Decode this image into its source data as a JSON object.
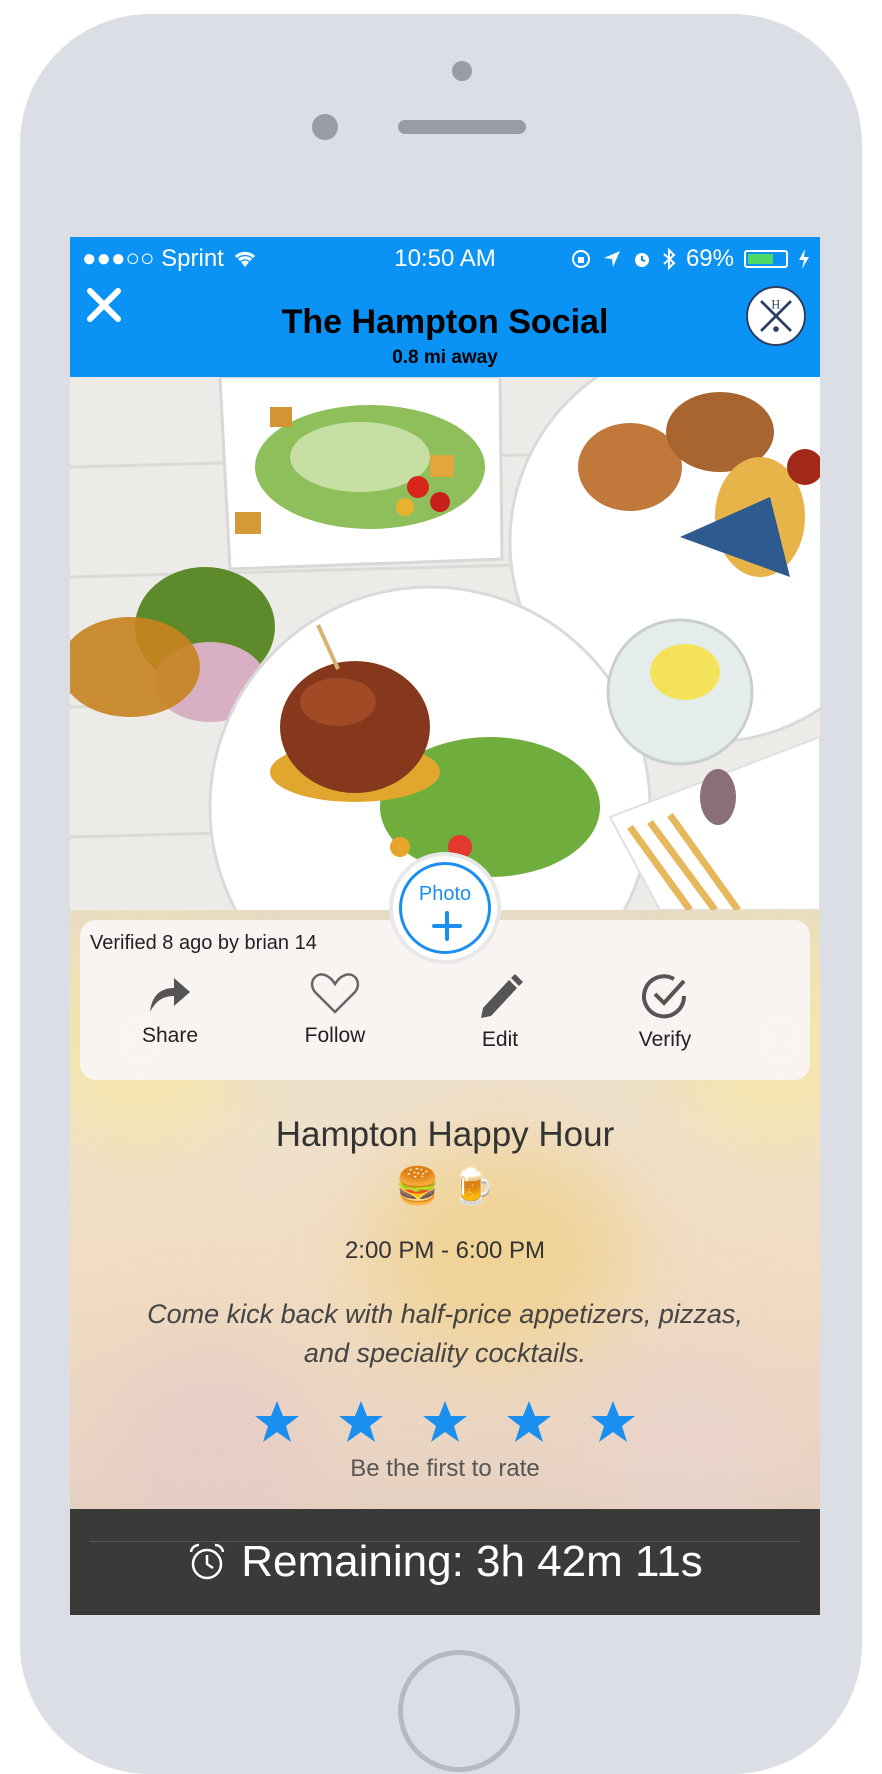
{
  "status_bar": {
    "carrier": "●●●○○ Sprint",
    "time": "10:50 AM",
    "battery": "69%",
    "battery_level": 0.69
  },
  "header": {
    "title": "The Hampton Social",
    "subtitle": "0.8 mi away"
  },
  "photo_button": {
    "label": "Photo"
  },
  "action_card": {
    "verified_text": "Verified 8 ago by brian 14",
    "actions": [
      {
        "label": "Share",
        "icon": "share-icon"
      },
      {
        "label": "Follow",
        "icon": "heart-icon"
      },
      {
        "label": "Edit",
        "icon": "pencil-icon"
      },
      {
        "label": "Verify",
        "icon": "check-circle-icon"
      }
    ]
  },
  "deal": {
    "title": "Hampton Happy Hour",
    "emoji": "🍔 🍺",
    "hours": "2:00 PM - 6:00 PM",
    "description": "Come kick back with half-price appetizers, pizzas, and speciality cocktails."
  },
  "rating": {
    "stars": 5,
    "prompt": "Be the first to rate"
  },
  "timer": {
    "text": "Remaining: 3h 42m 11s"
  },
  "colors": {
    "accent": "#0a93f5",
    "star": "#1a8ff0",
    "timer_bg": "#2e2e2e"
  }
}
